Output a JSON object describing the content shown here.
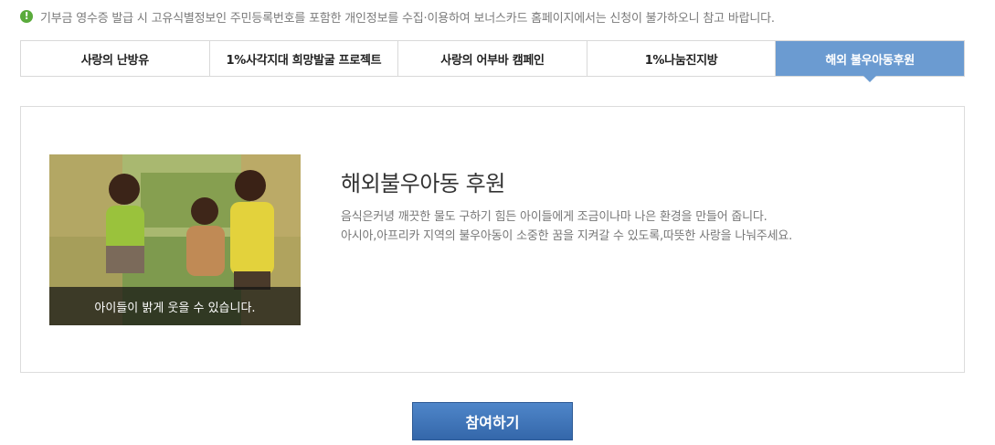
{
  "notice": {
    "icon": "exclamation-icon",
    "text": "기부금 영수증 발급 시 고유식별정보인 주민등록번호를 포함한 개인정보를 수집·이용하여 보너스카드 홈페이지에서는 신청이 불가하오니 참고 바랍니다."
  },
  "tabs": [
    {
      "label": "사랑의 난방유",
      "active": false
    },
    {
      "label": "1%사각지대 희망발굴 프로젝트",
      "active": false
    },
    {
      "label": "사랑의 어부바 캠페인",
      "active": false
    },
    {
      "label": "1%나눔진지방",
      "active": false
    },
    {
      "label": "해외 불우아동후원",
      "active": true
    }
  ],
  "content": {
    "photo_caption": "아이들이 밝게 웃을 수 있습니다.",
    "heading": "해외불우아동 후원",
    "desc_line1": "음식은커녕 깨끗한 물도 구하기 힘든 아이들에게 조금이나마 나은 환경을 만들어 줍니다.",
    "desc_line2": "아시아,아프리카 지역의 불우아동이 소중한 꿈을 지켜갈 수 있도록,따뜻한 사랑을 나눠주세요."
  },
  "join_button": "참여하기",
  "colors": {
    "accent": "#6b9bd1",
    "button": "#3f75b9",
    "notice_icon": "#5aab3c"
  }
}
